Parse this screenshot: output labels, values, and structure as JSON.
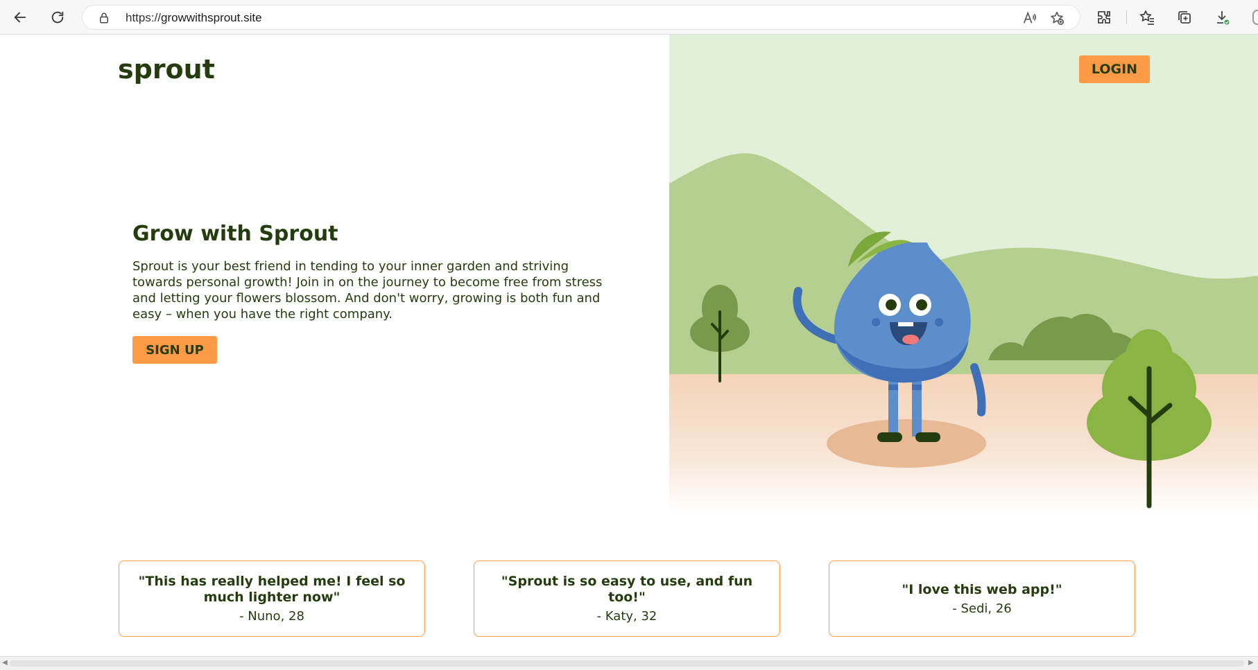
{
  "browser": {
    "url_prefix": "https://",
    "url_host": "growwithsprout.site"
  },
  "header": {
    "logo_text": "sprout",
    "login_label": "LOGIN"
  },
  "hero": {
    "title": "Grow with Sprout",
    "description": "Sprout is your best friend in tending to your inner garden and striving towards personal growth! Join in on the journey to become free from stress and letting your flowers blossom. And don't worry, growing is both fun and easy – when you have the right company.",
    "signup_label": "SIGN UP"
  },
  "testimonials": [
    {
      "quote": "\"This has really helped me! I feel so much lighter now\"",
      "author": "- Nuno, 28"
    },
    {
      "quote": "\"Sprout is so easy to use, and fun too!\"",
      "author": "- Katy, 32"
    },
    {
      "quote": "\"I love this web app!\"",
      "author": "- Sedi, 26"
    }
  ],
  "colors": {
    "accent": "#fd9a45",
    "text_dark_green": "#253d0e",
    "sky": "#e2f0d9",
    "hills": "#b5cf91",
    "ground": "#f4d3b8",
    "character_blue": "#5b8ecb"
  },
  "icons": {
    "back": "back-arrow-icon",
    "reload": "reload-icon",
    "lock": "lock-icon",
    "read_aloud": "read-aloud-icon",
    "favorite_add": "favorite-add-icon",
    "extensions": "extensions-icon",
    "favorites": "favorites-icon",
    "collections": "collections-icon",
    "downloads": "downloads-icon"
  }
}
